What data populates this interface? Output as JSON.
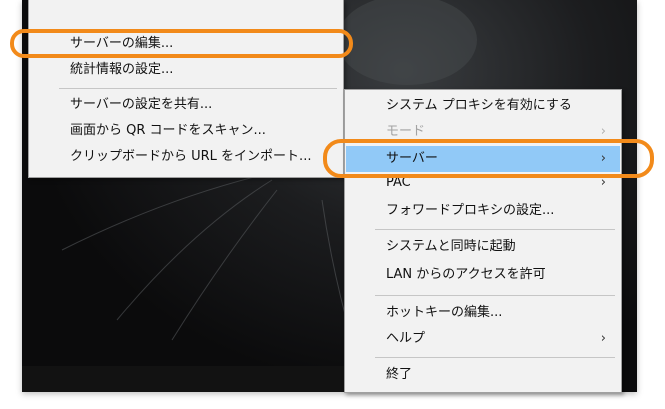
{
  "server_submenu": {
    "items": [
      {
        "label": "サーバーの編集..."
      },
      {
        "label": "統計情報の設定..."
      },
      {
        "label": "サーバーの設定を共有..."
      },
      {
        "label": "画面から QR コードをスキャン..."
      },
      {
        "label": "クリップボードから URL をインポート..."
      }
    ]
  },
  "main_menu": {
    "items": [
      {
        "label": "システム プロキシを有効にする"
      },
      {
        "label": "モード",
        "disabled": true,
        "submenu": true
      },
      {
        "label": "サーバー",
        "highlighted": true,
        "submenu": true
      },
      {
        "label": "PAC",
        "submenu": true
      },
      {
        "label": "フォワードプロキシの設定..."
      },
      {
        "label": "システムと同時に起動"
      },
      {
        "label": "LAN からのアクセスを許可"
      },
      {
        "label": "ホットキーの編集..."
      },
      {
        "label": "ヘルプ",
        "submenu": true
      },
      {
        "label": "終了"
      }
    ],
    "arrow_glyph": "›"
  },
  "colors": {
    "menu_background": "#f2f2f2",
    "highlight": "#91c9f7",
    "callout": "#f28a1a",
    "disabled_text": "#a3a3a3"
  }
}
